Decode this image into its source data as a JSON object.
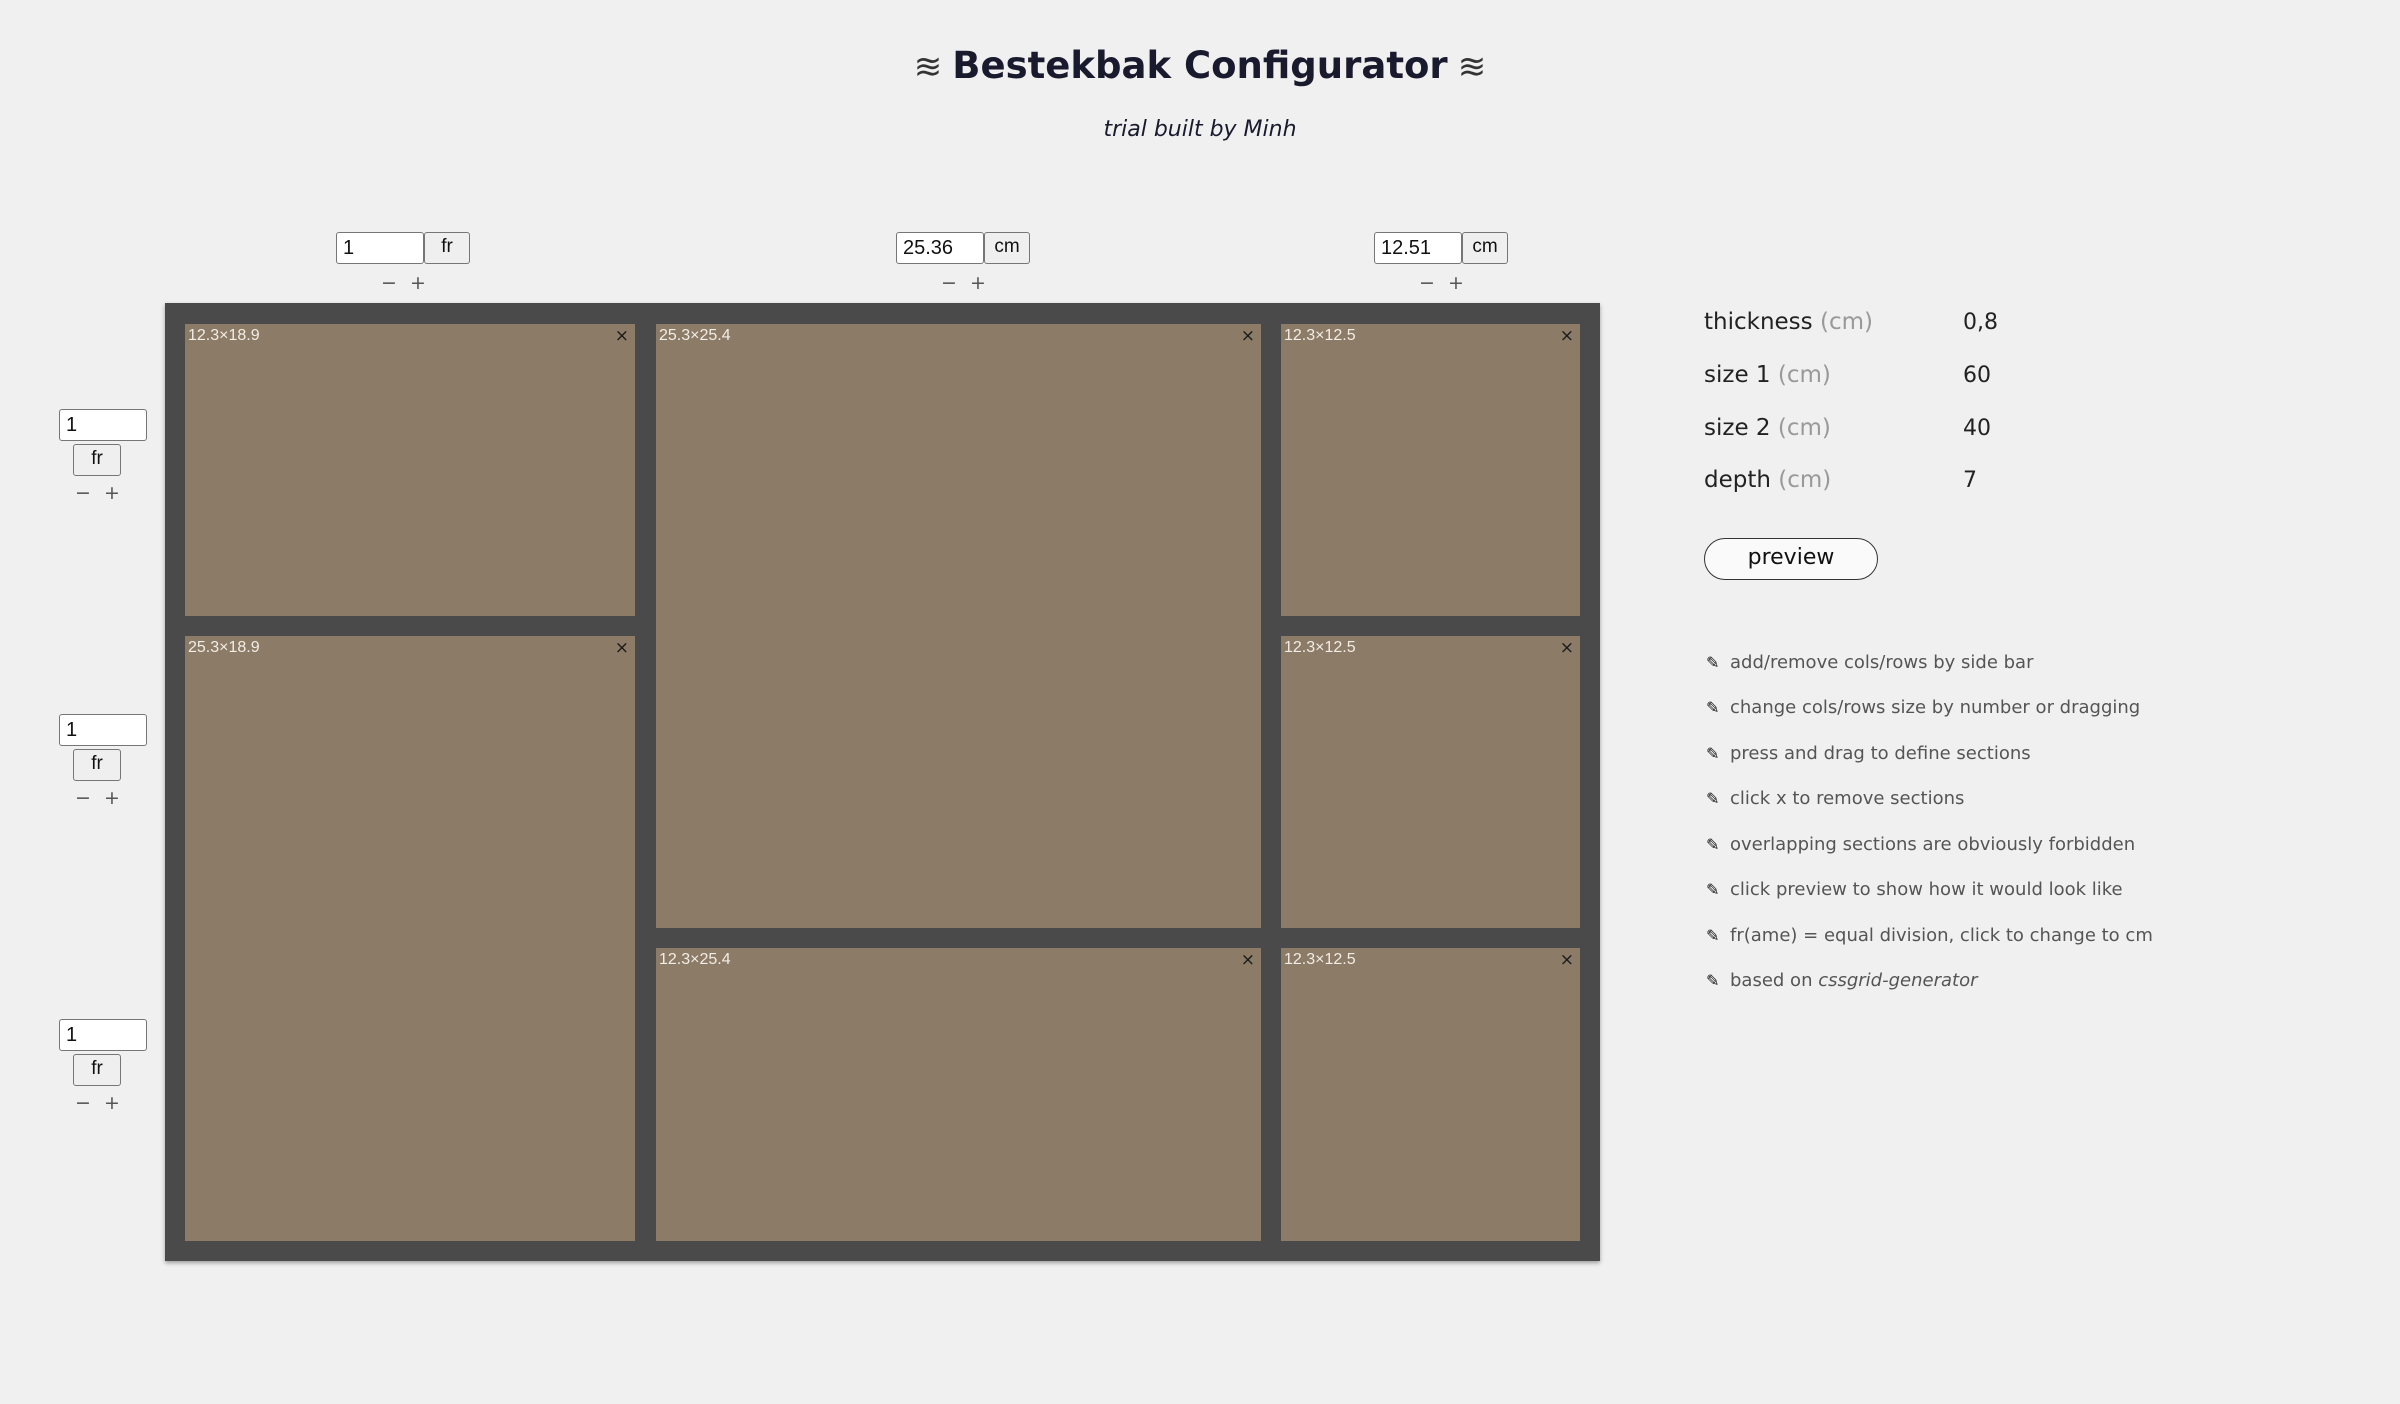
{
  "header": {
    "title": "Bestekbak Configurator",
    "title_decoration_left": "≋",
    "title_decoration_right": "≋",
    "subtitle": "trial built by Minh"
  },
  "columns": [
    {
      "value": "1",
      "unit": "fr",
      "minus": "−",
      "plus": "+"
    },
    {
      "value": "25.36",
      "unit": "cm",
      "minus": "−",
      "plus": "+"
    },
    {
      "value": "12.51",
      "unit": "cm",
      "minus": "−",
      "plus": "+"
    }
  ],
  "rows": [
    {
      "value": "1",
      "unit": "fr",
      "minus": "−",
      "plus": "+"
    },
    {
      "value": "1",
      "unit": "fr",
      "minus": "−",
      "plus": "+"
    },
    {
      "value": "1",
      "unit": "fr",
      "minus": "−",
      "plus": "+"
    }
  ],
  "sections": [
    {
      "label": "12.3×18.9",
      "close": "×"
    },
    {
      "label": "25.3×25.4",
      "close": "×"
    },
    {
      "label": "12.3×12.5",
      "close": "×"
    },
    {
      "label": "25.3×18.9",
      "close": "×"
    },
    {
      "label": "12.3×12.5",
      "close": "×"
    },
    {
      "label": "12.3×25.4",
      "close": "×"
    },
    {
      "label": "12.3×12.5",
      "close": "×"
    }
  ],
  "properties": [
    {
      "label": "thickness",
      "unit": "(cm)",
      "value": "0,8"
    },
    {
      "label": "size 1",
      "unit": "(cm)",
      "value": "60"
    },
    {
      "label": "size 2",
      "unit": "(cm)",
      "value": "40"
    },
    {
      "label": "depth",
      "unit": "(cm)",
      "value": "7"
    }
  ],
  "preview_label": "preview",
  "tips": [
    "add/remove cols/rows by side bar",
    "change cols/rows size by number or dragging",
    "press and drag to define sections",
    "click x to remove sections",
    "overlapping sections are obviously forbidden",
    "click preview to show how it would look like",
    "fr(ame) = equal division, click to change to cm"
  ],
  "tip_last": {
    "prefix": "based on ",
    "link": "cssgrid-generator"
  },
  "tip_icon": "✎",
  "colors": {
    "background": "#f0f0f0",
    "frame": "#4a4a4a",
    "section": "#8c7b67"
  }
}
